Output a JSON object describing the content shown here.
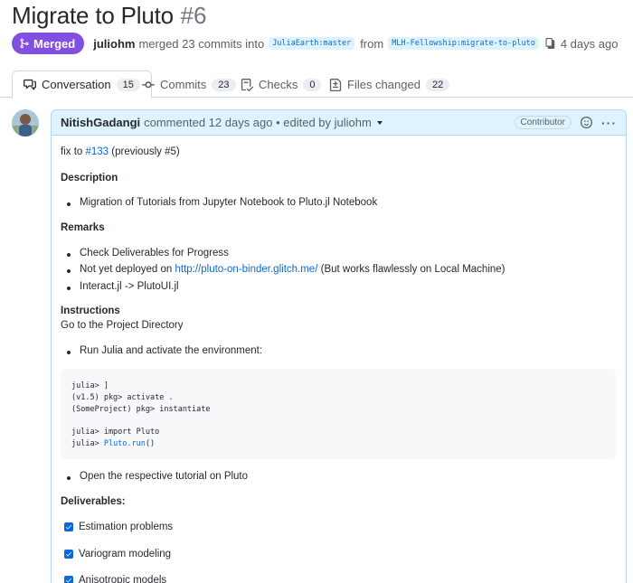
{
  "pr": {
    "title": "Migrate to Pluto",
    "number": "#6",
    "status": "Merged",
    "author": "juliohm",
    "action": "merged 23 commits into",
    "base_branch": "JuliaEarth:master",
    "from_text": "from",
    "head_branch": "MLH-Fellowship:migrate-to-pluto",
    "time": "4 days ago",
    "status_color": "#8250df"
  },
  "tabs": [
    {
      "label": "Conversation",
      "count": "15",
      "icon": "comment-icon"
    },
    {
      "label": "Commits",
      "count": "23",
      "icon": "commit-icon"
    },
    {
      "label": "Checks",
      "count": "0",
      "icon": "checklist-icon"
    },
    {
      "label": "Files changed",
      "count": "22",
      "icon": "file-diff-icon"
    }
  ],
  "comment": {
    "author": "NitishGadangi",
    "meta": "commented 12 days ago • edited by juliohm",
    "badge": "Contributor",
    "fix_prefix": "fix to",
    "fix_link": "#133",
    "fix_suffix": "(previously #5)",
    "description_heading": "Description",
    "description_items": [
      "Migration of Tutorials from Jupyter Notebook to Pluto.jl Notebook"
    ],
    "remarks_heading": "Remarks",
    "remark_1": "Check Deliverables for Progress",
    "remark_2_prefix": "Not yet deployed on",
    "remark_2_link": "http://pluto-on-binder.glitch.me/",
    "remark_2_suffix": "(But works flawlessly on Local Machine)",
    "remark_3": "Interact.jl -> PlutoUI.jl",
    "instructions_heading": "Instructions",
    "instructions_text": "Go to the Project Directory",
    "instruction_item_1": "Run Julia and activate the environment:",
    "code_lines": {
      "l1": "julia> ]",
      "l2": "(v1.5) pkg> activate .",
      "l3": "(SomeProject) pkg> instantiate",
      "l5": "julia> import Pluto",
      "l6_prefix": "julia> ",
      "l6_fn": "Pluto.run",
      "l6_suffix": "()"
    },
    "instruction_item_2": "Open the respective tutorial on Pluto",
    "deliverables_heading": "Deliverables:",
    "deliverables": [
      {
        "label": "Estimation problems",
        "checked": true
      },
      {
        "label": "Variogram modeling",
        "checked": true
      },
      {
        "label": "Anisotropic models",
        "checked": true
      }
    ]
  }
}
